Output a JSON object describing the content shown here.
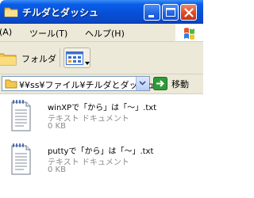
{
  "window": {
    "title": "チルダとダッシュ"
  },
  "menu": {
    "items": [
      {
        "label": "(A)"
      },
      {
        "label": "ツール(T)"
      },
      {
        "label": "ヘルプ(H)"
      }
    ]
  },
  "toolbar": {
    "folders_label": "フォルダ"
  },
  "address": {
    "path": "¥¥ss¥ファイル¥チルダとダッシュ",
    "go_label": "移動"
  },
  "files": [
    {
      "name": "winXPで「から」は「～」.txt",
      "type": "テキスト ドキュメント",
      "size": "0 KB",
      "icon": "text-document-icon"
    },
    {
      "name": "puttyで「から」は「〜」.txt",
      "type": "テキスト ドキュメント",
      "size": "0 KB",
      "icon": "text-document-icon"
    }
  ],
  "colors": {
    "titlebar": "#0a5ee8",
    "close_button": "#dd4a25",
    "chrome": "#ece9d8",
    "secondary_text": "#8a8a8a",
    "go_arrow": "#2f9a3a"
  }
}
